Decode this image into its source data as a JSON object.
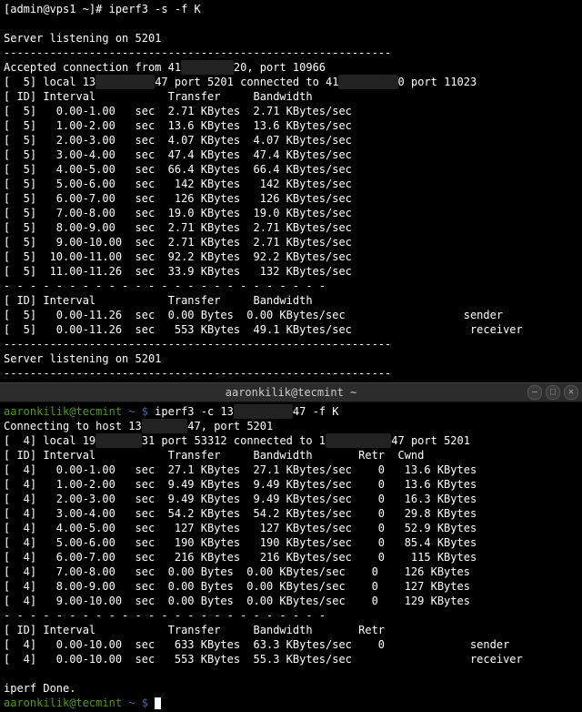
{
  "top": {
    "prompt_line": "[admin@vps1 ~]# iperf3 -s -f K",
    "listening1": "Server listening on 5201",
    "dashes1": "-----------------------------------------------------------",
    "accepted": {
      "pre": "Accepted connection from 41",
      "mask": "xxxxxxxx",
      "post": "20, port 10966"
    },
    "local": {
      "pre": "[  5] local 13",
      "mask1": "xxxxxxxxx",
      "mid": "47 port 5201 connected to 41",
      "mask2": "xxxxxxxxx",
      "post": "0 port 11023"
    },
    "header": "[ ID] Interval           Transfer     Bandwidth",
    "rows": [
      "[  5]   0.00-1.00   sec  2.71 KBytes  2.71 KBytes/sec",
      "[  5]   1.00-2.00   sec  13.6 KBytes  13.6 KBytes/sec",
      "[  5]   2.00-3.00   sec  4.07 KBytes  4.07 KBytes/sec",
      "[  5]   3.00-4.00   sec  47.4 KBytes  47.4 KBytes/sec",
      "[  5]   4.00-5.00   sec  66.4 KBytes  66.4 KBytes/sec",
      "[  5]   5.00-6.00   sec   142 KBytes   142 KBytes/sec",
      "[  5]   6.00-7.00   sec   126 KBytes   126 KBytes/sec",
      "[  5]   7.00-8.00   sec  19.0 KBytes  19.0 KBytes/sec",
      "[  5]   8.00-9.00   sec  2.71 KBytes  2.71 KBytes/sec",
      "[  5]   9.00-10.00  sec  2.71 KBytes  2.71 KBytes/sec",
      "[  5]  10.00-11.00  sec  92.2 KBytes  92.2 KBytes/sec",
      "[  5]  11.00-11.26  sec  33.9 KBytes   132 KBytes/sec"
    ],
    "sep": "- - - - - - - - - - - - - - - - - - - - - - - - -",
    "header2": "[ ID] Interval           Transfer     Bandwidth",
    "sum1": "[  5]   0.00-11.26  sec  0.00 Bytes  0.00 KBytes/sec                  sender",
    "sum2": "[  5]   0.00-11.26  sec   553 KBytes  49.1 KBytes/sec                  receiver",
    "dashes2": "-----------------------------------------------------------",
    "listening2": "Server listening on 5201",
    "dashes3": "-----------------------------------------------------------"
  },
  "titlebar": {
    "title": "aaronkilik@tecmint ~"
  },
  "bottom": {
    "prompt": {
      "user": "aaronkilik@tecmint",
      "tilde": " ~ $ ",
      "cmd_pre": "iperf3 -c 13",
      "mask": "xxxxxxxxx",
      "cmd_post": "47 -f K"
    },
    "connect": {
      "pre": "Connecting to host 13",
      "mask": "xxxxxxx",
      "post": "47, port 5201"
    },
    "local": {
      "pre": "[  4] local 19",
      "mask1": "xxxxxxx",
      "mid": "31 port 53312 connected to 1",
      "mask2": "xxxxxxxxxx",
      "post": "47 port 5201"
    },
    "header": "[ ID] Interval           Transfer     Bandwidth       Retr  Cwnd",
    "rows": [
      "[  4]   0.00-1.00   sec  27.1 KBytes  27.1 KBytes/sec    0   13.6 KBytes",
      "[  4]   1.00-2.00   sec  9.49 KBytes  9.49 KBytes/sec    0   13.6 KBytes",
      "[  4]   2.00-3.00   sec  9.49 KBytes  9.49 KBytes/sec    0   16.3 KBytes",
      "[  4]   3.00-4.00   sec  54.2 KBytes  54.2 KBytes/sec    0   29.8 KBytes",
      "[  4]   4.00-5.00   sec   127 KBytes   127 KBytes/sec    0   52.9 KBytes",
      "[  4]   5.00-6.00   sec   190 KBytes   190 KBytes/sec    0   85.4 KBytes",
      "[  4]   6.00-7.00   sec   216 KBytes   216 KBytes/sec    0    115 KBytes",
      "[  4]   7.00-8.00   sec  0.00 Bytes  0.00 KBytes/sec    0    126 KBytes",
      "[  4]   8.00-9.00   sec  0.00 Bytes  0.00 KBytes/sec    0    127 KBytes",
      "[  4]   9.00-10.00  sec  0.00 Bytes  0.00 KBytes/sec    0    129 KBytes"
    ],
    "sep": "- - - - - - - - - - - - - - - - - - - - - - - - -",
    "header2": "[ ID] Interval           Transfer     Bandwidth       Retr",
    "sum1": "[  4]   0.00-10.00  sec   633 KBytes  63.3 KBytes/sec    0             sender",
    "sum2": "[  4]   0.00-10.00  sec   553 KBytes  55.3 KBytes/sec                  receiver",
    "done": "iperf Done.",
    "prompt2": {
      "user": "aaronkilik@tecmint",
      "tilde": " ~ $ "
    }
  }
}
